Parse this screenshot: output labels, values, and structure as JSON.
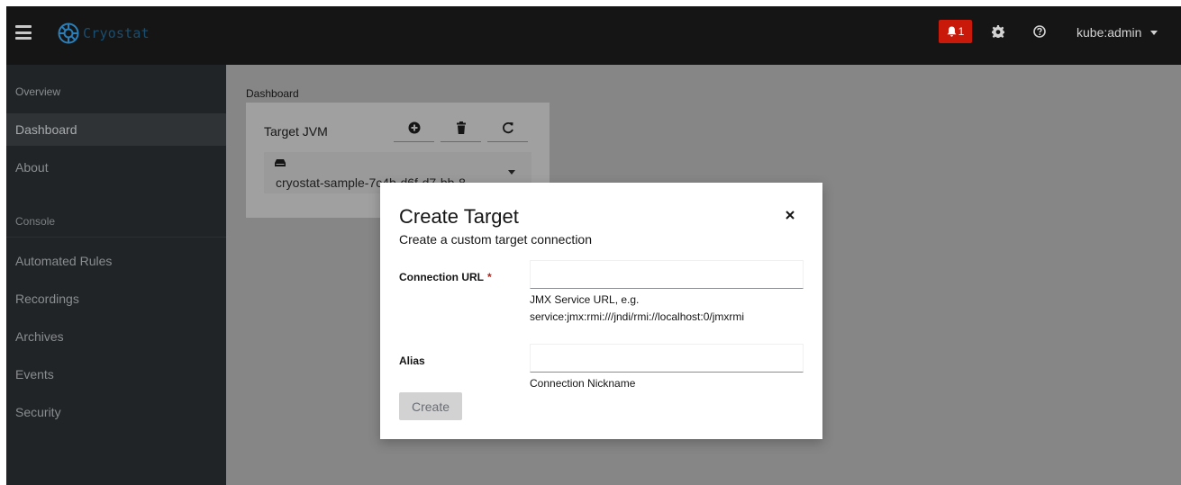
{
  "app": {
    "brand": "Cryostat"
  },
  "masthead": {
    "notification_count": "1",
    "user": "kube:admin",
    "colors": {
      "bg": "#151515",
      "alert": "#c9190b"
    }
  },
  "sidebar": {
    "items_top": [
      {
        "label": "Overview"
      },
      {
        "label": "Dashboard",
        "active": true
      },
      {
        "label": "About"
      }
    ],
    "section_label": "Console",
    "items_console": [
      {
        "label": "Automated Rules"
      },
      {
        "label": "Recordings"
      },
      {
        "label": "Archives"
      },
      {
        "label": "Events"
      },
      {
        "label": "Security"
      }
    ]
  },
  "main": {
    "breadcrumb": "Dashboard",
    "target_card": {
      "title": "Target JVM",
      "selected_target": "cryostat-sample-7c4b-d6f-d7-bb-8"
    }
  },
  "modal": {
    "title": "Create Target",
    "description": "Create a custom target connection",
    "fields": {
      "connection_url": {
        "label": "Connection URL",
        "required_marker": "*",
        "value": "",
        "helper_line1": "JMX Service URL, e.g.",
        "helper_line2": "service:jmx:rmi:///jndi/rmi://localhost:0/jmxrmi"
      },
      "alias": {
        "label": "Alias",
        "value": "",
        "helper": "Connection Nickname"
      }
    },
    "submit_label": "Create"
  }
}
